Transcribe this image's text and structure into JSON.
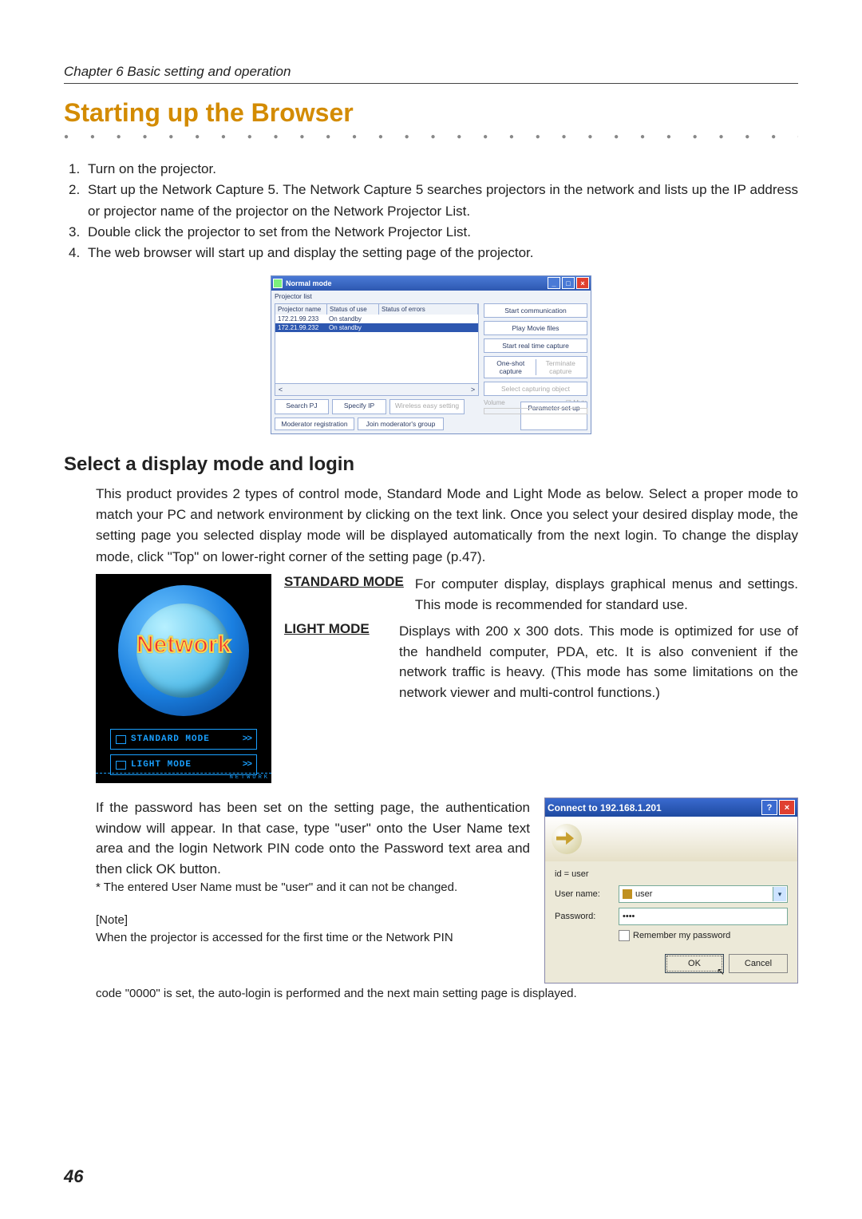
{
  "chapter": "Chapter 6 Basic setting and operation",
  "h1": "Starting up the Browser",
  "steps": [
    {
      "n": "1.",
      "t": "Turn on the projector."
    },
    {
      "n": "2.",
      "t": "Start up the Network Capture 5. The Network Capture 5 searches projectors in the network and lists up the IP address or projector name of the projector on the Network Projector List."
    },
    {
      "n": "3.",
      "t": "Double click the projector to set from the Network Projector List."
    },
    {
      "n": "4.",
      "t": "The web browser will start up and display the setting page of the projector."
    }
  ],
  "nm": {
    "title": "Normal mode",
    "list_label": "Projector list",
    "cols": [
      "Projector name",
      "Status of use",
      "Status of errors"
    ],
    "rows": [
      {
        "c": [
          "172.21.99.233",
          "On standby",
          ""
        ],
        "sel": false
      },
      {
        "c": [
          "172.21.99.232",
          "On standby",
          ""
        ],
        "sel": true
      }
    ],
    "right": {
      "start": "Start communication",
      "play": "Play Movie files",
      "realtime": "Start real time capture",
      "oneshot": "One-shot capture",
      "terminate": "Terminate capture",
      "selobj": "Select capturing object"
    },
    "bottom": {
      "search": "Search PJ",
      "specify": "Specify IP",
      "wireless": "Wireless easy setting",
      "param": "Parameter set up",
      "modreg": "Moderator registration",
      "join": "Join moderator's group"
    },
    "volume_label": "Volume",
    "mute": "Mute"
  },
  "h2": "Select a display mode and login",
  "p2": "This product provides 2 types of control mode, Standard Mode and Light Mode as below. Select a proper mode to match your PC and network environment by clicking on the text link. Once you select your desired display mode, the setting page you selected display mode will be displayed automatically from the next login. To change the display mode, click \"Top\" on lower-right corner of the setting page (p.47).",
  "logo": {
    "word": "Network",
    "std": "STANDARD MODE",
    "light": "LIGHT MODE",
    "foot": "NETWORK"
  },
  "modes": {
    "std_label": "STANDARD MODE",
    "std_desc": "For computer display, displays graphical menus and settings. This mode is recommended for standard use.",
    "light_label": "LIGHT MODE",
    "light_desc": "Displays with 200 x 300 dots. This mode is optimized for use of the handheld computer, PDA, etc. It is also convenient if the network traffic is heavy. (This mode has some limitations on the network viewer and multi-control functions.)"
  },
  "pw": {
    "para": "If the password has been set on the setting page, the authentication window will appear. In that case, type \"user\" onto the User Name text area and the login Network PIN code onto the Password text area and then click OK button.",
    "small": "* The entered User Name must be \"user\" and it can not be changed.",
    "note_label": "[Note]",
    "note_line1": "When the projector is accessed for the first time or the Network PIN",
    "note_line2": "code \"0000\" is set, the auto-login is performed and the next main setting page is displayed."
  },
  "login": {
    "title": "Connect to 192.168.1.201",
    "realm": "id = user",
    "user_label": "User name:",
    "user_value": "user",
    "pw_label": "Password:",
    "pw_value": "••••",
    "remember": "Remember my password",
    "ok": "OK",
    "cancel": "Cancel"
  },
  "page_number": "46"
}
